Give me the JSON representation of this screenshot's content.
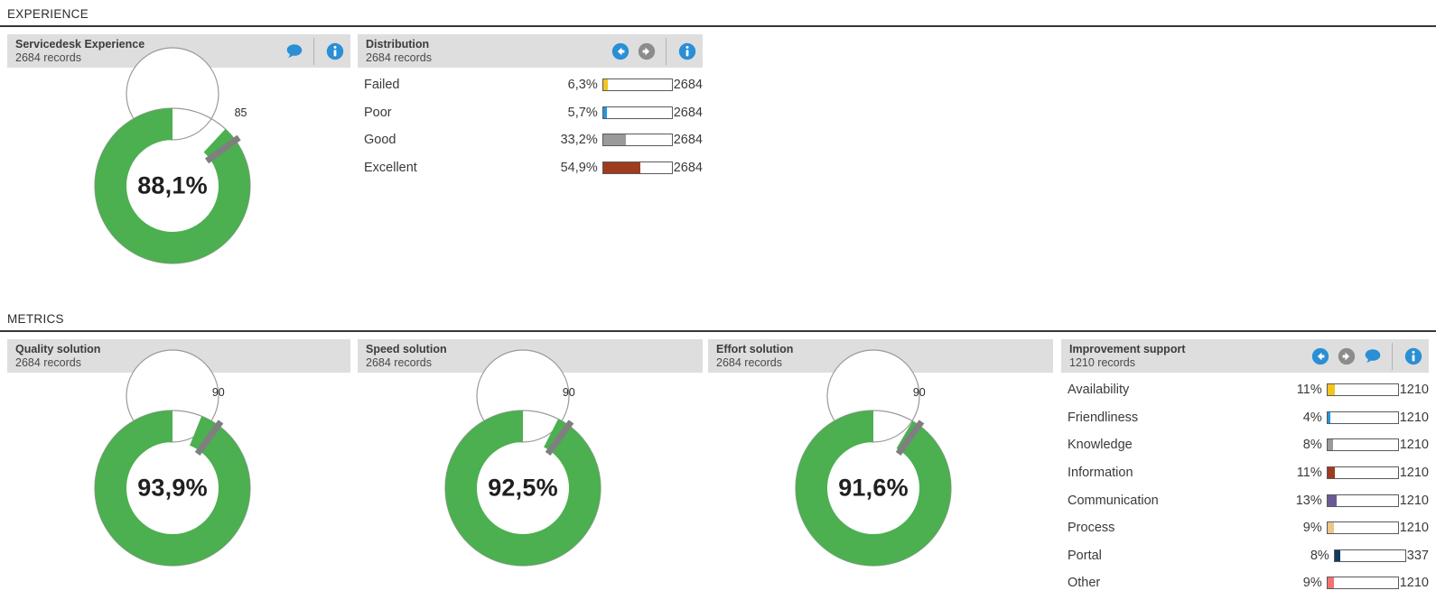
{
  "sections": {
    "experience": {
      "label": "EXPERIENCE"
    },
    "metrics": {
      "label": "METRICS"
    }
  },
  "colors": {
    "gauge_fill": "#4caf50",
    "gauge_track": "#ffffff",
    "gauge_outline": "#9a9a9a",
    "target_marker": "#7f7f7f",
    "panel_header_bg": "#dedede",
    "icon_blue": "#2a8fd4",
    "icon_grey": "#8c8c8c",
    "rule": "#33383d"
  },
  "experience": {
    "gauge_panel": {
      "title": "Servicedesk Experience",
      "subtitle": "2684 records",
      "icons": [
        "comment-icon",
        "info-icon"
      ]
    },
    "gauge": {
      "value_label": "88,1%",
      "value": 88.1,
      "target_label": "85",
      "target": 85
    },
    "distribution_panel": {
      "title": "Distribution",
      "subtitle": "2684 records",
      "icons": [
        "arrow-left-icon",
        "arrow-right-icon",
        "info-icon"
      ]
    },
    "distribution_rows": [
      {
        "label": "Failed",
        "pct_label": "6,3%",
        "pct": 6.3,
        "count": "2684",
        "color": "#f2c520"
      },
      {
        "label": "Poor",
        "pct_label": "5,7%",
        "pct": 5.7,
        "count": "2684",
        "color": "#2196e3"
      },
      {
        "label": "Good",
        "pct_label": "33,2%",
        "pct": 33.2,
        "count": "2684",
        "color": "#9a9a9a"
      },
      {
        "label": "Excellent",
        "pct_label": "54,9%",
        "pct": 54.9,
        "count": "2684",
        "color": "#9e3c1f"
      }
    ]
  },
  "metrics": {
    "gauge_panels": [
      {
        "title": "Quality solution",
        "subtitle": "2684 records",
        "value_label": "93,9%",
        "value": 93.9,
        "target_label": "90",
        "target": 90
      },
      {
        "title": "Speed solution",
        "subtitle": "2684 records",
        "value_label": "92,5%",
        "value": 92.5,
        "target_label": "90",
        "target": 90
      },
      {
        "title": "Effort solution",
        "subtitle": "2684 records",
        "value_label": "91,6%",
        "value": 91.6,
        "target_label": "90",
        "target": 90
      }
    ],
    "improvement_panel": {
      "title": "Improvement support",
      "subtitle": "1210 records",
      "icons": [
        "arrow-left-icon",
        "arrow-right-icon",
        "comment-icon",
        "info-icon"
      ]
    },
    "improvement_rows": [
      {
        "label": "Availability",
        "pct_label": "11%",
        "pct": 11,
        "count": "1210",
        "color": "#f2c520"
      },
      {
        "label": "Friendliness",
        "pct_label": "4%",
        "pct": 4,
        "count": "1210",
        "color": "#2196e3"
      },
      {
        "label": "Knowledge",
        "pct_label": "8%",
        "pct": 8,
        "count": "1210",
        "color": "#9a9a9a"
      },
      {
        "label": "Information",
        "pct_label": "11%",
        "pct": 11,
        "count": "1210",
        "color": "#9e3c1f"
      },
      {
        "label": "Communication",
        "pct_label": "13%",
        "pct": 13,
        "count": "1210",
        "color": "#6b5b95"
      },
      {
        "label": "Process",
        "pct_label": "9%",
        "pct": 9,
        "count": "1210",
        "color": "#eec58a"
      },
      {
        "label": "Portal",
        "pct_label": "8%",
        "pct": 8,
        "count": "337",
        "color": "#123a5e"
      },
      {
        "label": "Other",
        "pct_label": "9%",
        "pct": 9,
        "count": "1210",
        "color": "#f4726e"
      }
    ]
  }
}
